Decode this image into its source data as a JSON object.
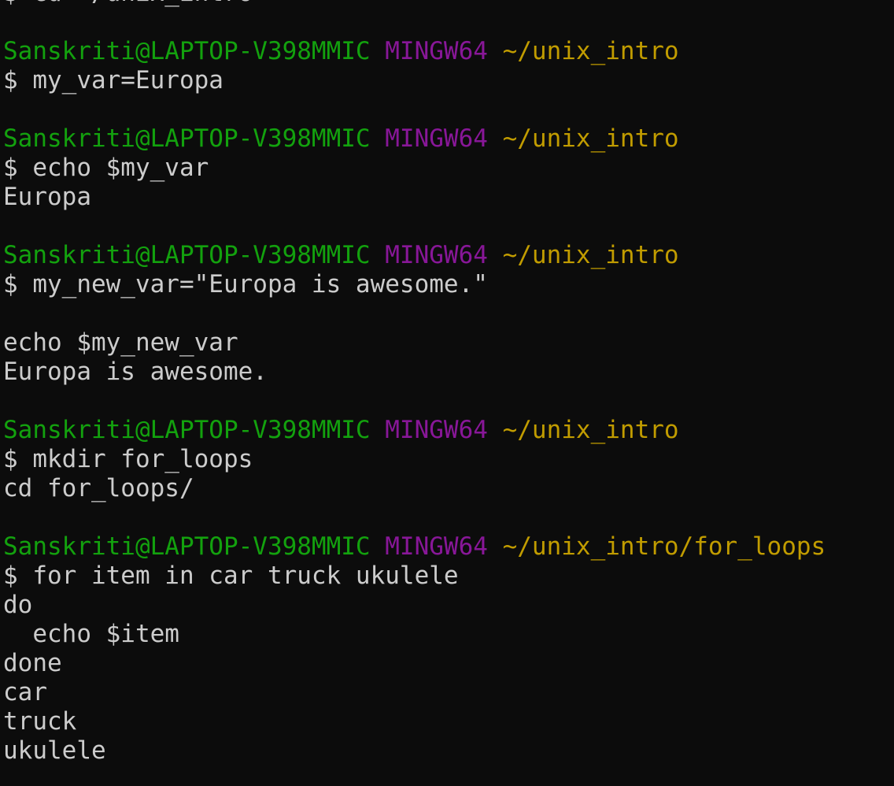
{
  "colors": {
    "background": "#0c0c0c",
    "text": "#cccccc",
    "user": "#13a10e",
    "system": "#881798",
    "path": "#c19c00"
  },
  "terminal": {
    "prompt_symbol": "$",
    "user_host": "Sanskriti@LAPTOP-V398MMIC",
    "system": "MINGW64",
    "lines": [
      {
        "kind": "cmd",
        "text": "$ cd ~/unix_intro"
      },
      {
        "kind": "blank"
      },
      {
        "kind": "prompt",
        "path": "~/unix_intro"
      },
      {
        "kind": "cmd",
        "text": "$ my_var=Europa"
      },
      {
        "kind": "blank"
      },
      {
        "kind": "prompt",
        "path": "~/unix_intro"
      },
      {
        "kind": "cmd",
        "text": "$ echo $my_var"
      },
      {
        "kind": "out",
        "text": "Europa"
      },
      {
        "kind": "blank"
      },
      {
        "kind": "prompt",
        "path": "~/unix_intro"
      },
      {
        "kind": "cmd",
        "text": "$ my_new_var=\"Europa is awesome.\""
      },
      {
        "kind": "blank"
      },
      {
        "kind": "out",
        "text": "echo $my_new_var"
      },
      {
        "kind": "out",
        "text": "Europa is awesome."
      },
      {
        "kind": "blank"
      },
      {
        "kind": "prompt",
        "path": "~/unix_intro"
      },
      {
        "kind": "cmd",
        "text": "$ mkdir for_loops"
      },
      {
        "kind": "out",
        "text": "cd for_loops/"
      },
      {
        "kind": "blank"
      },
      {
        "kind": "prompt",
        "path": "~/unix_intro/for_loops"
      },
      {
        "kind": "cmd",
        "text": "$ for item in car truck ukulele"
      },
      {
        "kind": "out",
        "text": "do"
      },
      {
        "kind": "out",
        "text": "  echo $item"
      },
      {
        "kind": "out",
        "text": "done"
      },
      {
        "kind": "out",
        "text": "car"
      },
      {
        "kind": "out",
        "text": "truck"
      },
      {
        "kind": "out",
        "text": "ukulele"
      }
    ]
  }
}
